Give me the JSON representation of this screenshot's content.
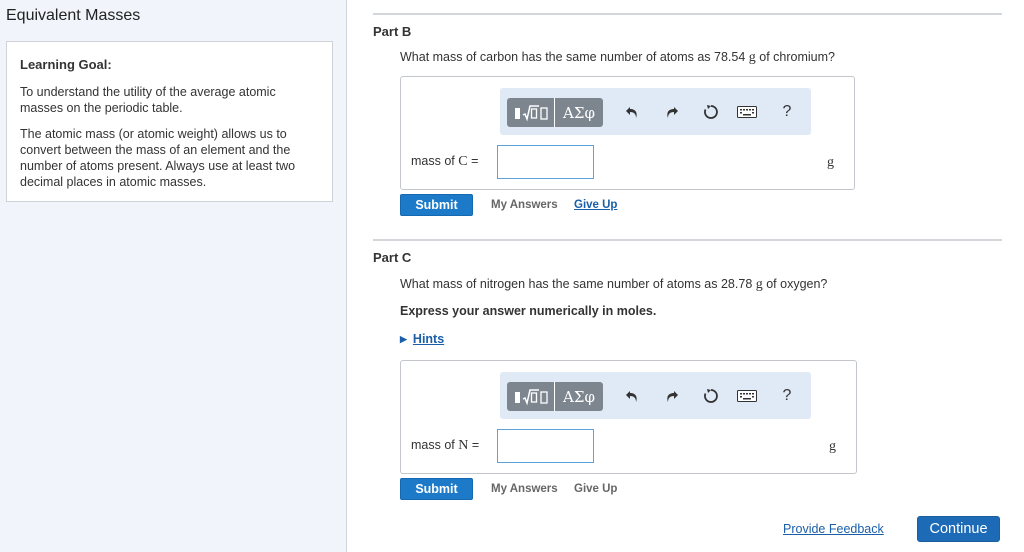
{
  "left": {
    "title": "Equivalent Masses",
    "goal_heading": "Learning Goal:",
    "goal_p1": "To understand the utility of the average atomic masses on the periodic table.",
    "goal_p2": "The atomic mass (or atomic weight) allows us to convert between the mass of an element and the number of atoms present. Always use at least two decimal places in atomic masses."
  },
  "partB": {
    "label": "Part B",
    "question_pre": "What mass of carbon has the same number of atoms as 78.54 ",
    "question_unit": "g",
    "question_post": " of chromium?",
    "field_label_pre": "mass of ",
    "field_symbol": "C",
    "field_label_post": " =",
    "input_value": "",
    "unit": "g",
    "submit": "Submit",
    "my_answers": "My Answers",
    "give_up": "Give Up"
  },
  "partC": {
    "label": "Part C",
    "question_pre": "What mass of nitrogen has the same number of atoms as 28.78 ",
    "question_unit": "g",
    "question_post": " of oxygen?",
    "instruction": "Express your answer numerically in moles.",
    "hints": "Hints",
    "field_label_pre": "mass of ",
    "field_symbol": "N",
    "field_label_post": " =",
    "input_value": "",
    "unit": "g",
    "submit": "Submit",
    "my_answers": "My Answers",
    "give_up": "Give Up"
  },
  "toolbar": {
    "greek": "ΑΣφ",
    "help": "?",
    "icons": [
      "template-icon",
      "greek-icon",
      "undo-icon",
      "redo-icon",
      "reset-icon",
      "keyboard-icon",
      "help-icon"
    ]
  },
  "footer": {
    "feedback": "Provide Feedback",
    "continue": "Continue"
  },
  "colors": {
    "accent": "#1c7ac8",
    "link": "#1a5fa8",
    "toolbar_bg": "#dfeaf6",
    "left_bg": "#f1f5fb"
  }
}
